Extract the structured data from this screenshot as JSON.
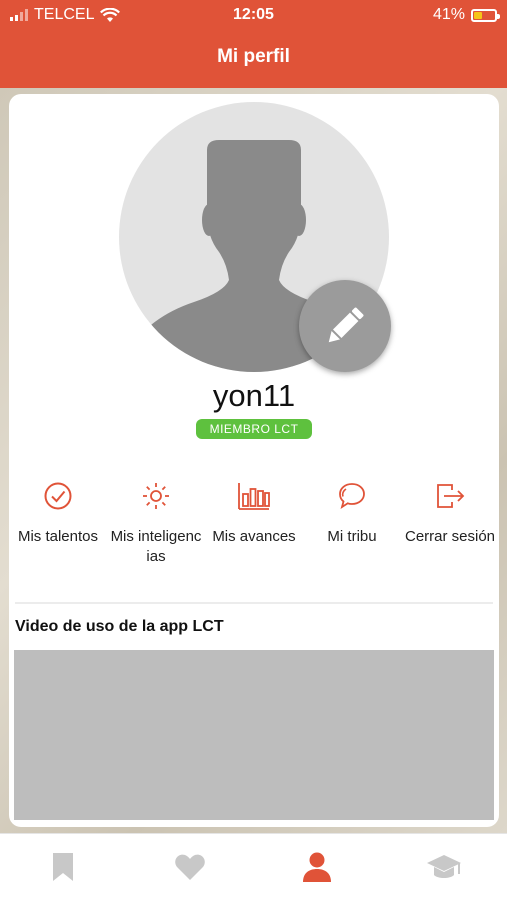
{
  "status_bar": {
    "carrier": "TELCEL",
    "time": "12:05",
    "battery": "41%"
  },
  "header": {
    "title": "Mi perfil"
  },
  "profile": {
    "username": "yon11",
    "badge": "MIEMBRO LCT"
  },
  "actions": [
    {
      "label": "Mis talentos",
      "icon": "check-circle-icon"
    },
    {
      "label": "Mis inteligencias",
      "icon": "sun-icon"
    },
    {
      "label": "Mis avances",
      "icon": "bar-chart-icon"
    },
    {
      "label": "Mi tribu",
      "icon": "chat-bubbles-icon"
    },
    {
      "label": "Cerrar sesión",
      "icon": "logout-icon"
    }
  ],
  "video_section": {
    "title": "Video de uso de la app LCT"
  },
  "tabs": [
    {
      "icon": "bookmark-icon",
      "active": false
    },
    {
      "icon": "heart-icon",
      "active": false
    },
    {
      "icon": "person-icon",
      "active": true
    },
    {
      "icon": "graduation-cap-icon",
      "active": false
    }
  ],
  "colors": {
    "accent": "#e05338",
    "badge": "#5ec13e",
    "inactive_tab": "#c8c8c8"
  }
}
